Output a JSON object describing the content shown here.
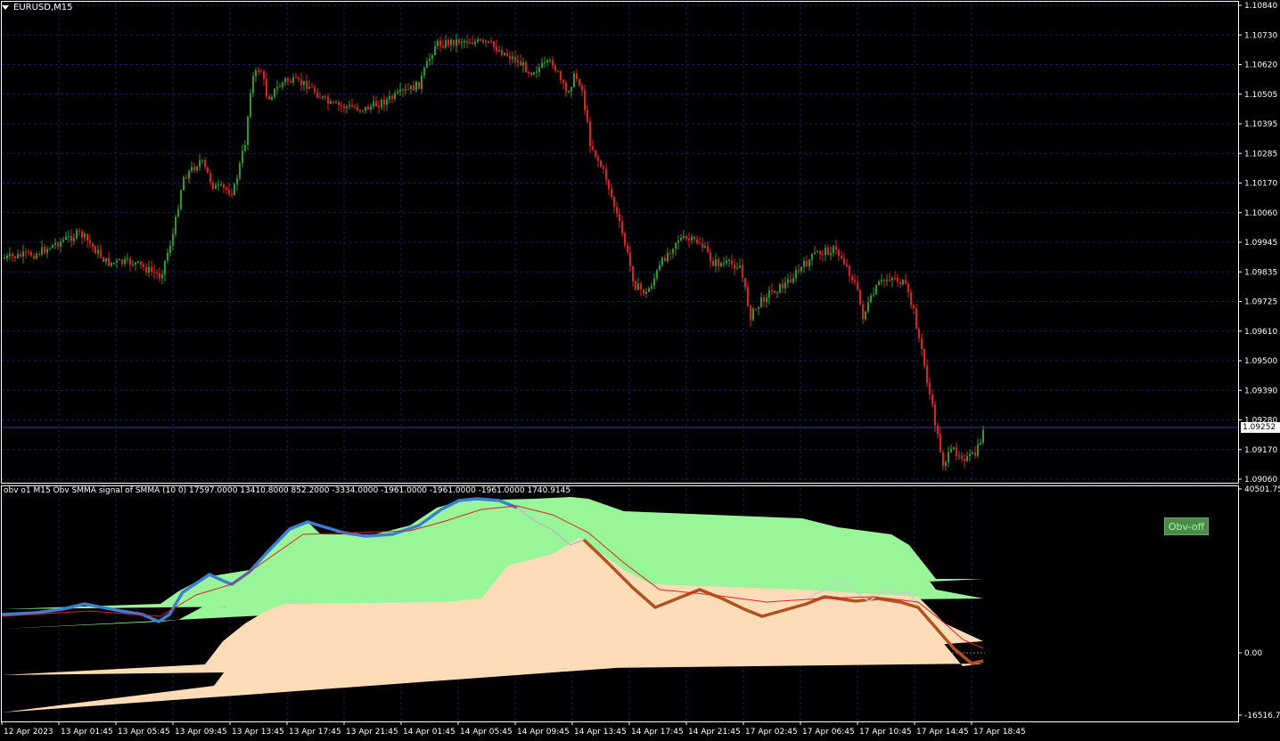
{
  "main": {
    "symbol_label": "EURUSD,M15",
    "current_price": "1.09252",
    "price_axis": [
      "1.10840",
      "1.10730",
      "1.10620",
      "1.10505",
      "1.10395",
      "1.10285",
      "1.10170",
      "1.10060",
      "1.09945",
      "1.09835",
      "1.09725",
      "1.09610",
      "1.09500",
      "1.09390",
      "1.09280",
      "1.09170",
      "1.09060"
    ],
    "time_axis": [
      "12 Apr 2023",
      "13 Apr 01:45",
      "13 Apr 05:45",
      "13 Apr 09:45",
      "13 Apr 13:45",
      "13 Apr 17:45",
      "13 Apr 21:45",
      "14 Apr 01:45",
      "14 Apr 05:45",
      "14 Apr 09:45",
      "14 Apr 13:45",
      "14 Apr 17:45",
      "14 Apr 21:45",
      "17 Apr 02:45",
      "17 Apr 06:45",
      "17 Apr 10:45",
      "17 Apr 14:45",
      "17 Apr 18:45"
    ]
  },
  "indicator": {
    "title": "obv o1 M15 Obv SMMA signal of SMMA (10 0) 17597.0000 13410.8000 852.2000 -3334.0000 -1961.0000 -1961.0000 -1961.0000 1740.9145",
    "axis": [
      "40501.75",
      "0.00",
      "-16516.75"
    ],
    "toggle_label": "Obv-off"
  },
  "colors": {
    "bull_candle": "#2e9a2e",
    "bear_candle": "#e02020",
    "grid": "#1c1c5e",
    "green_band": "#98f598",
    "peach_band": "#ffdcb8",
    "obv_up_line": "#3b7fd4",
    "obv_down_line": "#b0521e",
    "signal_line": "#e02020"
  }
}
